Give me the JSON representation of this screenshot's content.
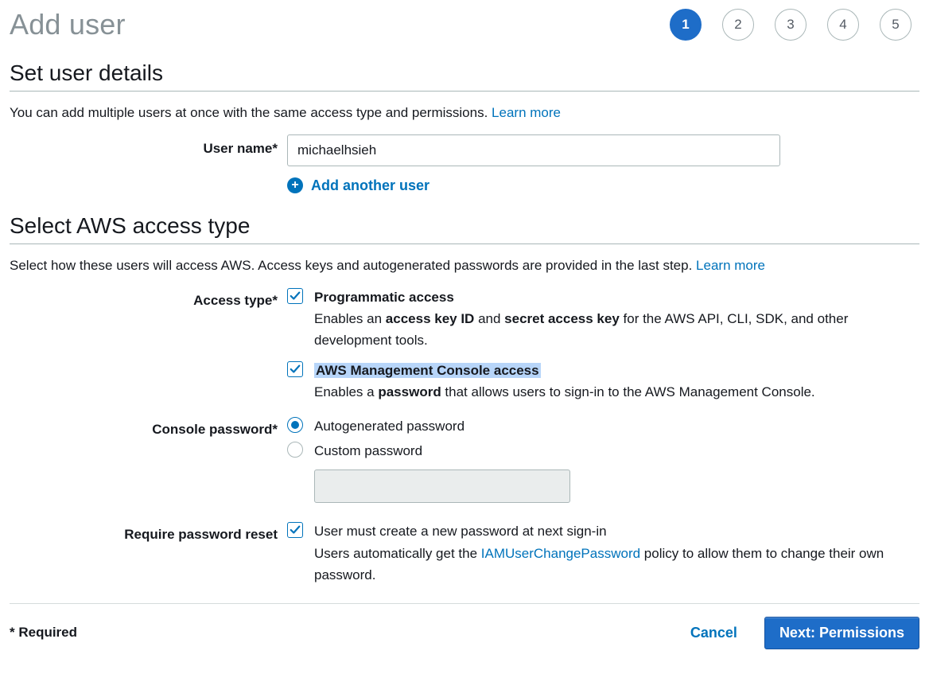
{
  "colors": {
    "accent": "#1E6DC8",
    "link": "#0073bb"
  },
  "header": {
    "title": "Add user"
  },
  "wizard": {
    "current": 1,
    "steps": [
      "1",
      "2",
      "3",
      "4",
      "5"
    ]
  },
  "userDetails": {
    "heading": "Set user details",
    "description": "You can add multiple users at once with the same access type and permissions. ",
    "learn_more": "Learn more",
    "username_label": "User name*",
    "username_value": "michaelhsieh",
    "add_another_label": "Add another user"
  },
  "accessType": {
    "heading": "Select AWS access type",
    "description": "Select how these users will access AWS. Access keys and autogenerated passwords are provided in the last step. ",
    "learn_more": "Learn more",
    "label": "Access type*",
    "programmatic": {
      "checked": true,
      "title": "Programmatic access",
      "desc_before": "Enables an ",
      "bold1": "access key ID",
      "mid": " and ",
      "bold2": "secret access key",
      "desc_after": " for the AWS API, CLI, SDK, and other development tools."
    },
    "console": {
      "checked": true,
      "highlighted": true,
      "title": "AWS Management Console access",
      "desc_before": "Enables a ",
      "bold1": "password",
      "desc_after": " that allows users to sign-in to the AWS Management Console."
    }
  },
  "password": {
    "label": "Console password*",
    "auto_label": "Autogenerated password",
    "custom_label": "Custom password",
    "selected": "auto"
  },
  "requireReset": {
    "label": "Require password reset",
    "checked": true,
    "line1": "User must create a new password at next sign-in",
    "line2_before": "Users automatically get the ",
    "policy_link": "IAMUserChangePassword",
    "line2_after": " policy to allow them to change their own password."
  },
  "footer": {
    "required_note": "* Required",
    "cancel": "Cancel",
    "next": "Next: Permissions"
  }
}
